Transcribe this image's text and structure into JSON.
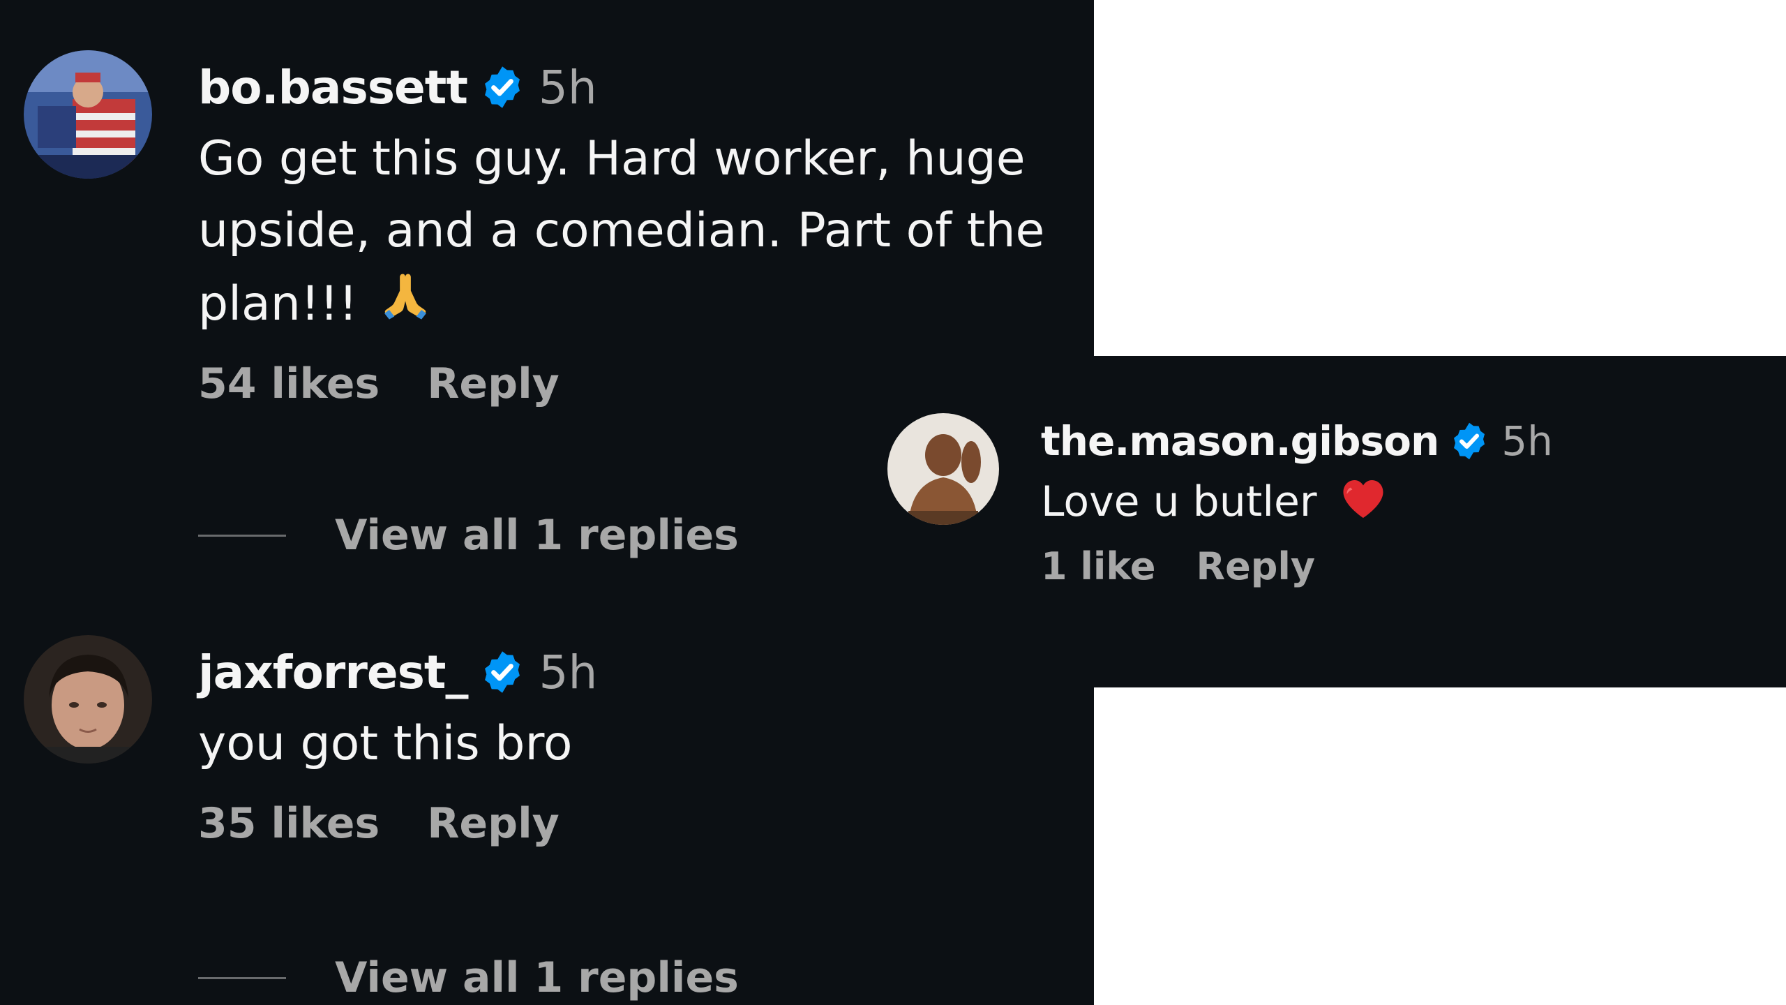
{
  "left_comments": [
    {
      "username": "bo.bassett",
      "verified_icon": "verified-badge-icon",
      "time": "5h",
      "text_lines": [
        "Go get this guy. Hard worker, huge",
        "upside, and a comedian. Part of the",
        "plan!!!"
      ],
      "emoji": "🙏",
      "likes": "54 likes",
      "reply": "Reply",
      "view_replies": "View all 1 replies"
    },
    {
      "username": "jaxforrest_",
      "verified_icon": "verified-badge-icon",
      "time": "5h",
      "text_lines": [
        "you got this bro"
      ],
      "likes": "35 likes",
      "reply": "Reply",
      "view_replies": "View all 1 replies"
    }
  ],
  "right_comment": {
    "username": "the.mason.gibson",
    "verified_icon": "verified-badge-icon",
    "time": "5h",
    "text": "Love u butler",
    "emoji": "❤️",
    "likes": "1 like",
    "reply": "Reply"
  },
  "colors": {
    "background": "#0c1014",
    "primary_text": "#f5f5f5",
    "secondary_text": "#a8a8a8",
    "verified_blue": "#0095f6",
    "heart_red": "#e0282e"
  }
}
